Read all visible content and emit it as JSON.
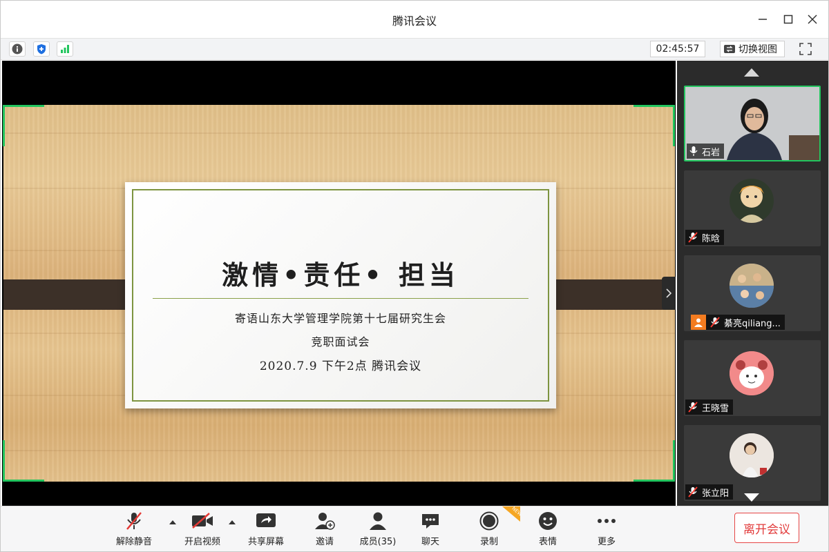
{
  "window": {
    "title": "腾讯会议"
  },
  "infobar": {
    "timer": "02:45:57",
    "switch_view_label": "切换视图"
  },
  "slide": {
    "title": "激情•责任• 担当",
    "line1": "寄语山东大学管理学院第十七届研究生会",
    "line2": "竞职面试会",
    "line3": "2020.7.9  下午2点  腾讯会议"
  },
  "participants": [
    {
      "name": "石岩",
      "muted": false,
      "active": true
    },
    {
      "name": "陈晗",
      "muted": true,
      "active": false
    },
    {
      "name": "綦亮qiliang...",
      "muted": true,
      "active": false,
      "host": true
    },
    {
      "name": "王晓雪",
      "muted": true,
      "active": false
    },
    {
      "name": "张立阳",
      "muted": true,
      "active": false
    }
  ],
  "toolbar": {
    "unmute": "解除静音",
    "start_video": "开启视频",
    "share_screen": "共享屏幕",
    "invite": "邀请",
    "members": "成员(35)",
    "chat": "聊天",
    "record": "录制",
    "record_badge": "NEW",
    "emoji": "表情",
    "more": "更多",
    "leave": "离开会议"
  },
  "colors": {
    "accent_green": "#22c55e",
    "leave_red": "#e23b3b",
    "host_orange": "#f47c20"
  }
}
